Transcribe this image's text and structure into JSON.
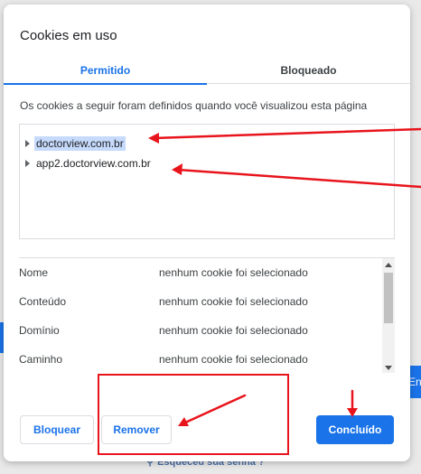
{
  "background": {
    "right_button_text": "Entr",
    "forgot_link": "Esqueceu sua senha ?"
  },
  "dialog": {
    "title": "Cookies em uso",
    "tabs": [
      {
        "label": "Permitido",
        "active": true
      },
      {
        "label": "Bloqueado",
        "active": false
      }
    ],
    "description": "Os cookies a seguir foram definidos quando você visualizou esta página",
    "sites": [
      {
        "label": "doctorview.com.br",
        "selected": true
      },
      {
        "label": "app2.doctorview.com.br",
        "selected": false
      }
    ],
    "details": [
      {
        "key": "Nome",
        "value": "nenhum cookie foi selecionado"
      },
      {
        "key": "Conteúdo",
        "value": "nenhum cookie foi selecionado"
      },
      {
        "key": "Domínio",
        "value": "nenhum cookie foi selecionado"
      },
      {
        "key": "Caminho",
        "value": "nenhum cookie foi selecionado"
      }
    ],
    "buttons": {
      "block": "Bloquear",
      "remove": "Remover",
      "done": "Concluído"
    }
  },
  "colors": {
    "accent": "#1a73e8",
    "annotation": "#e8141c",
    "selection": "#c6dafc"
  }
}
